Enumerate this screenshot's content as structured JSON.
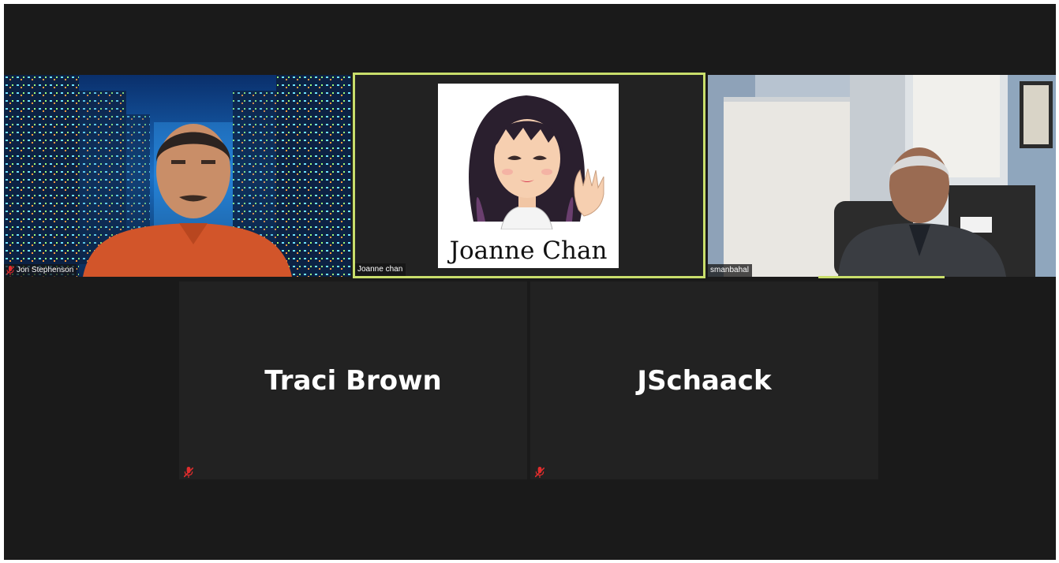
{
  "colors": {
    "background": "#1a1a1a",
    "tile": "#222222",
    "active_speaker": "#c9de6b",
    "mute_red": "#e02d2d"
  },
  "participants": [
    {
      "name": "Jon Stephenson",
      "muted": true,
      "video": true
    },
    {
      "name": "Joanne chan",
      "muted": false,
      "video": true,
      "avatar_text": "Joanne Chan",
      "active_speaker": true
    },
    {
      "name": "smanbahal",
      "muted": false,
      "video": true
    },
    {
      "name": "Traci Brown",
      "muted": true,
      "video": false
    },
    {
      "name": "JSchaack",
      "muted": true,
      "video": false
    }
  ]
}
